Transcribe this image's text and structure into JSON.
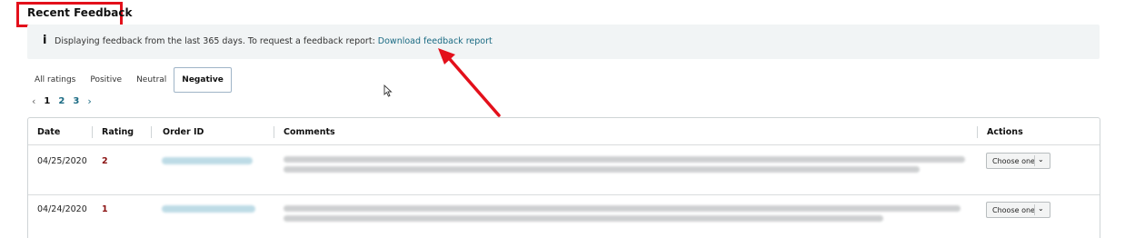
{
  "header": {
    "title": "Recent Feedback"
  },
  "info": {
    "icon": "info-icon",
    "icon_glyph": "i",
    "text": "Displaying feedback from the last 365 days. To request a feedback report: ",
    "link": "Download feedback report"
  },
  "tabs": [
    {
      "label": "All ratings",
      "active": false
    },
    {
      "label": "Positive",
      "active": false
    },
    {
      "label": "Neutral",
      "active": false
    },
    {
      "label": "Negative",
      "active": true
    }
  ],
  "pagination": {
    "prev": "‹",
    "current": "1",
    "pages": [
      "2",
      "3"
    ],
    "next": "›"
  },
  "table": {
    "columns": [
      "Date",
      "Rating",
      "Order ID",
      "Comments",
      "Actions"
    ],
    "rows": [
      {
        "date": "04/25/2020",
        "rating": "2",
        "action": "Choose one"
      },
      {
        "date": "04/24/2020",
        "rating": "1",
        "action": "Choose one"
      }
    ]
  },
  "colors": {
    "highlight": "#e3101b",
    "link": "#1a6a83",
    "rating": "#8a0f0f",
    "info_bg": "#f1f4f5"
  }
}
